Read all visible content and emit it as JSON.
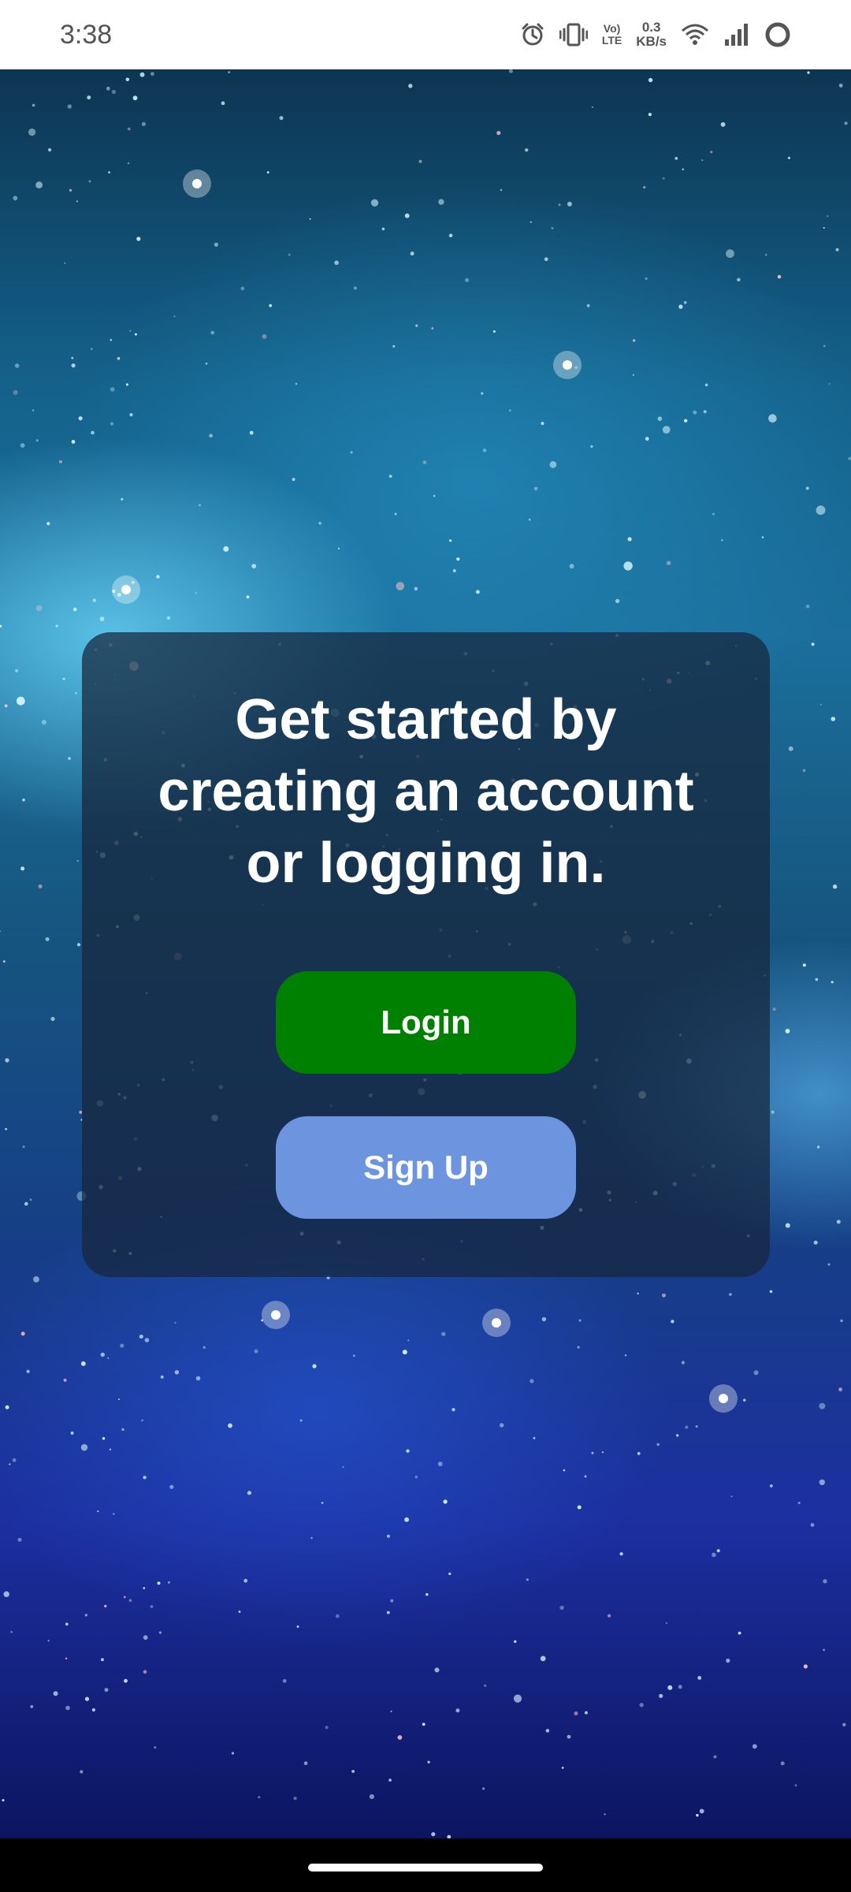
{
  "status_bar": {
    "time": "3:38",
    "volte_top": "Vo)",
    "volte_bottom": "LTE",
    "net_speed_value": "0.3",
    "net_speed_unit": "KB/s"
  },
  "card": {
    "headline": "Get started by creating an account or logging in."
  },
  "buttons": {
    "login_label": "Login",
    "signup_label": "Sign Up"
  },
  "colors": {
    "login_button": "#008000",
    "signup_button": "#6d95df",
    "card_overlay": "rgba(22, 38, 60, 0.72)"
  },
  "icons": {
    "alarm": "alarm-icon",
    "vibrate": "vibrate-icon",
    "wifi": "wifi-icon",
    "signal": "signal-icon",
    "battery": "battery-ring-icon"
  }
}
